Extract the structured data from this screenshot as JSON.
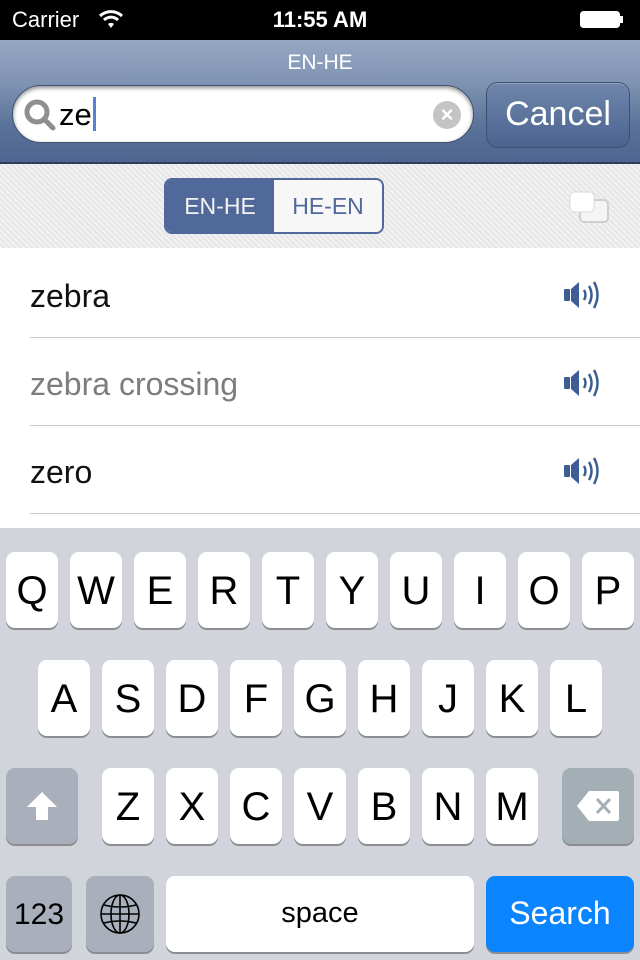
{
  "status_bar": {
    "carrier": "Carrier",
    "time": "11:55 AM",
    "wifi_icon": "wifi-icon",
    "battery_icon": "battery-icon"
  },
  "nav": {
    "title": "EN-HE",
    "search": {
      "value": "ze",
      "placeholder": "",
      "search_icon": "search-icon",
      "clear_icon": "clear-icon"
    },
    "cancel_label": "Cancel"
  },
  "toolbar": {
    "segments": [
      {
        "label": "EN-HE",
        "selected": true
      },
      {
        "label": "HE-EN",
        "selected": false
      }
    ],
    "copy_icon": "copy-icon"
  },
  "results": [
    {
      "word": "zebra",
      "dimmed": false,
      "icon": "speaker-icon"
    },
    {
      "word": "zebra crossing",
      "dimmed": true,
      "icon": "speaker-icon"
    },
    {
      "word": "zero",
      "dimmed": false,
      "icon": "speaker-icon"
    }
  ],
  "keyboard": {
    "row1": [
      "Q",
      "W",
      "E",
      "R",
      "T",
      "Y",
      "U",
      "I",
      "O",
      "P"
    ],
    "row2": [
      "A",
      "S",
      "D",
      "F",
      "G",
      "H",
      "J",
      "K",
      "L"
    ],
    "row3": [
      "Z",
      "X",
      "C",
      "V",
      "B",
      "N",
      "M"
    ],
    "shift_icon": "shift-icon",
    "delete_icon": "delete-icon",
    "numbers_label": "123",
    "globe_icon": "globe-icon",
    "space_label": "space",
    "search_label": "Search"
  },
  "colors": {
    "accent": "#50699a",
    "search_key": "#0a84ff",
    "speaker": "#3d5e95"
  }
}
